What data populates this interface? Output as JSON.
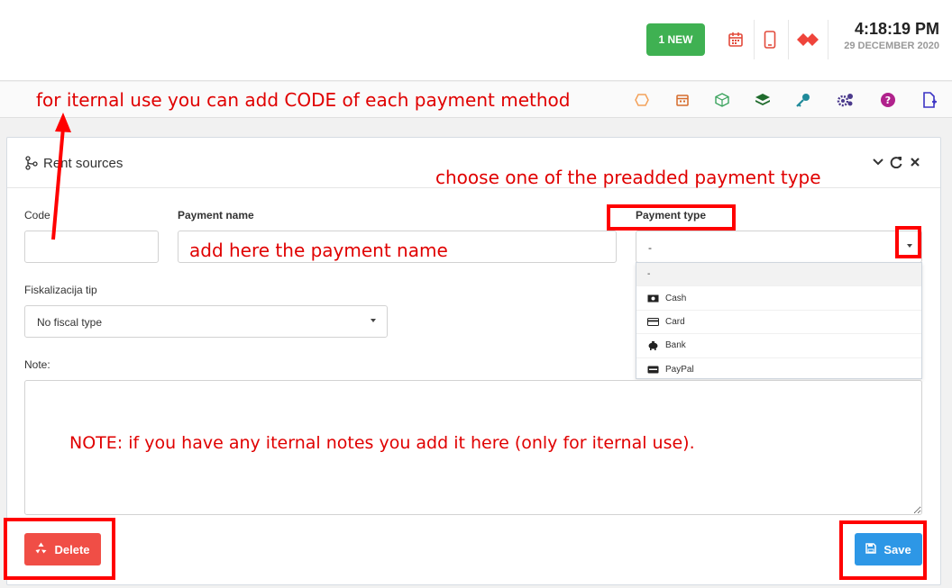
{
  "header": {
    "new_badge": "1 NEW",
    "time": "4:18:19 PM",
    "date": "29 DECEMBER 2020",
    "icons": [
      "calendar-icon",
      "mobile-phone-icon",
      "anydesk-icon"
    ]
  },
  "toolbar": {
    "icons": [
      "hexagon-icon",
      "calendar-icon",
      "cube-icon",
      "layers-icon",
      "key-icon",
      "settings-cogs-icon",
      "help-icon",
      "new-document-icon"
    ]
  },
  "panel": {
    "title": "Rent sources",
    "controls": [
      "chevron-down-icon",
      "refresh-icon",
      "close-icon"
    ]
  },
  "form": {
    "code_label": "Code",
    "code_value": "",
    "payment_name_label": "Payment name",
    "payment_name_value": "",
    "payment_type_label": "Payment type",
    "payment_type_selected": "-",
    "payment_type_options": [
      {
        "label": "-",
        "icon": ""
      },
      {
        "label": "Cash",
        "icon": "cash-icon"
      },
      {
        "label": "Card",
        "icon": "credit-card-icon"
      },
      {
        "label": "Bank",
        "icon": "piggy-bank-icon"
      },
      {
        "label": "PayPal",
        "icon": "paypal-card-icon"
      }
    ],
    "fiscal_label": "Fiskalizacija tip",
    "fiscal_selected": "No fiscal type",
    "note_label": "Note:",
    "note_value": ""
  },
  "actions": {
    "delete_label": "Delete",
    "save_label": "Save"
  },
  "annotations": {
    "code_hint": "for iternal use you can add CODE of each payment method",
    "payment_type_hint": "choose one of the preadded payment type",
    "payment_name_hint": "add here the payment name",
    "note_hint": "NOTE: if you have any iternal notes you add it here (only for iternal use)."
  },
  "colors": {
    "new_badge": "#3fb152",
    "delete": "#f04e46",
    "save": "#2d97e6",
    "annotation": "#e00000",
    "highlight": "#ff0000"
  }
}
